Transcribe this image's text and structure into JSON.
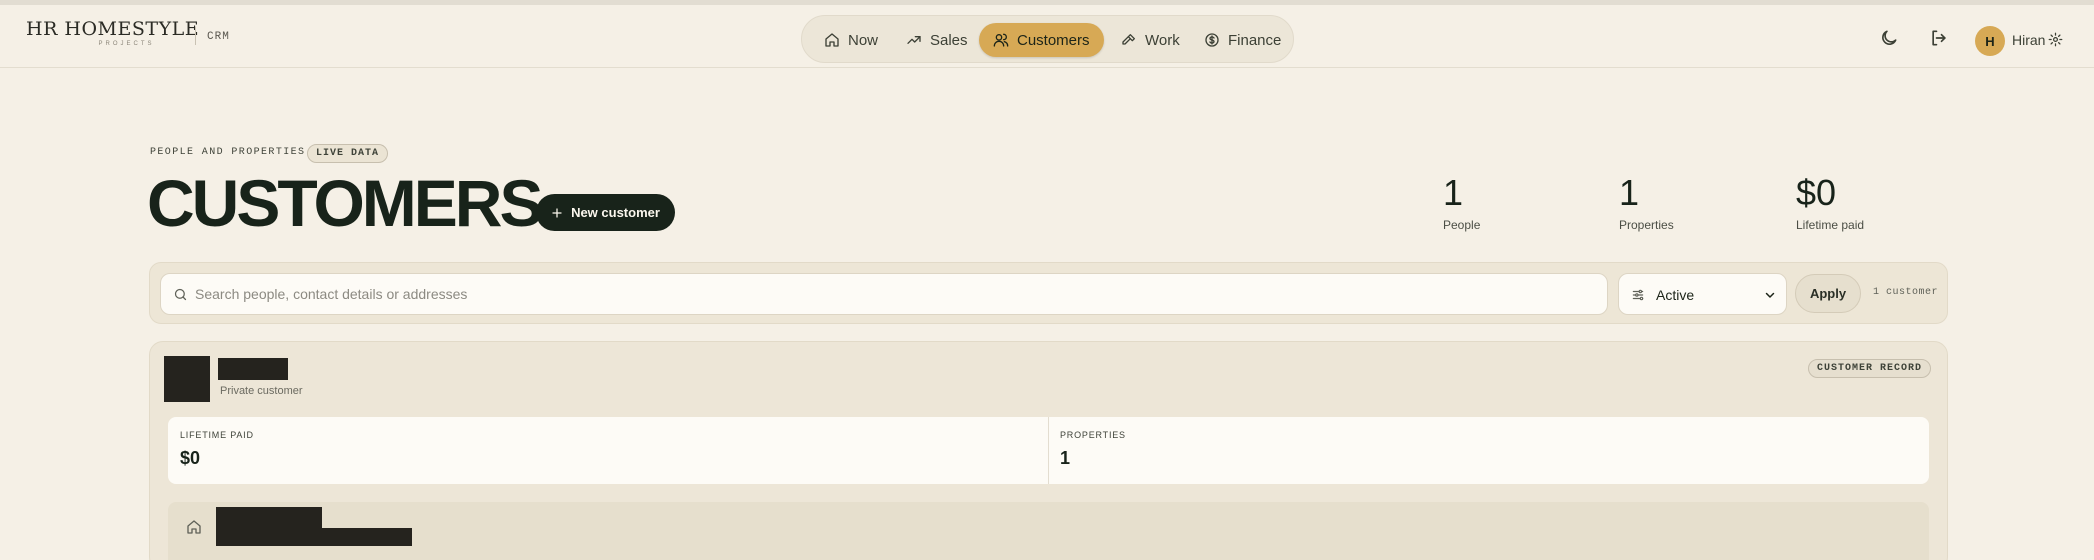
{
  "header": {
    "logo_main": "HR HOMESTYLE",
    "logo_sub": "PROJECTS",
    "app_tag": "CRM",
    "nav": [
      {
        "label": "Now",
        "icon": "home-icon"
      },
      {
        "label": "Sales",
        "icon": "trend-up-icon"
      },
      {
        "label": "Customers",
        "icon": "users-icon",
        "active": true
      },
      {
        "label": "Work",
        "icon": "hammer-icon"
      },
      {
        "label": "Finance",
        "icon": "dollar-circle-icon"
      }
    ],
    "user": {
      "initial": "H",
      "name": "Hiran"
    }
  },
  "page": {
    "eyebrow": "PEOPLE AND PROPERTIES",
    "live_badge": "LIVE DATA",
    "title": "CUSTOMERS",
    "new_button": "New customer"
  },
  "stats": [
    {
      "value": "1",
      "label": "People"
    },
    {
      "value": "1",
      "label": "Properties"
    },
    {
      "value": "$0",
      "label": "Lifetime paid"
    }
  ],
  "filters": {
    "search_placeholder": "Search people, contact details or addresses",
    "status_value": "Active",
    "apply_label": "Apply",
    "result_count": "1 customer"
  },
  "customer": {
    "type": "Private customer",
    "badge": "CUSTOMER RECORD",
    "metrics": [
      {
        "label": "LIFETIME PAID",
        "value": "$0"
      },
      {
        "label": "PROPERTIES",
        "value": "1"
      }
    ]
  },
  "colors": {
    "background": "#f5f0e6",
    "accent": "#d7a955",
    "dark": "#18231a"
  }
}
